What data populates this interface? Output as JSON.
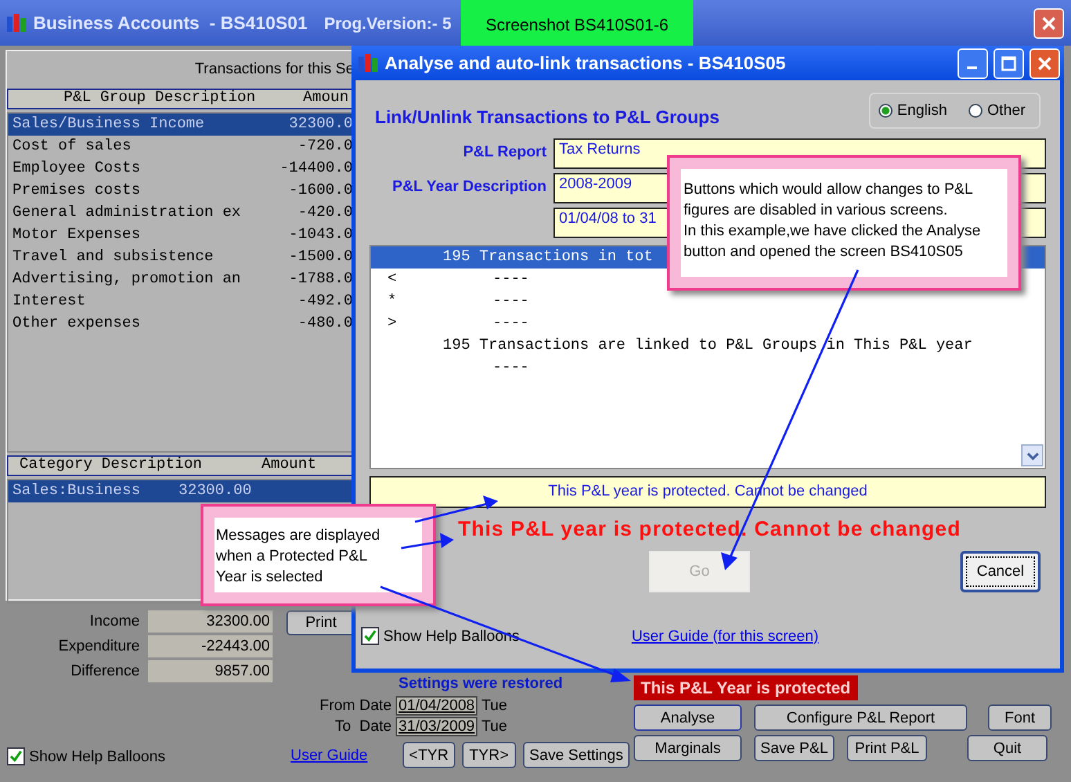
{
  "main_window": {
    "title": "Business Accounts  - BS410S01",
    "version": "Prog.Version:- 5",
    "heading": "Transactions for this Se",
    "group_table": {
      "columns": [
        "P&L Group Description",
        "Amoun"
      ],
      "rows": [
        {
          "description": "Sales/Business Income",
          "amount": "32300.0",
          "selected": true
        },
        {
          "description": "Cost of sales",
          "amount": "-720.0",
          "selected": false
        },
        {
          "description": "Employee Costs",
          "amount": "-14400.0",
          "selected": false
        },
        {
          "description": "Premises costs",
          "amount": "-1600.0",
          "selected": false
        },
        {
          "description": "General administration ex",
          "amount": "-420.0",
          "selected": false
        },
        {
          "description": "Motor Expenses",
          "amount": "-1043.0",
          "selected": false
        },
        {
          "description": "Travel and subsistence",
          "amount": "-1500.0",
          "selected": false
        },
        {
          "description": "Advertising, promotion an",
          "amount": "-1788.0",
          "selected": false
        },
        {
          "description": "Interest",
          "amount": "-492.0",
          "selected": false
        },
        {
          "description": "Other expenses",
          "amount": "-480.0",
          "selected": false
        }
      ]
    },
    "category_table": {
      "columns": [
        "Category Description",
        "Amount"
      ],
      "rows": [
        {
          "description": "Sales:Business",
          "amount": "32300.00",
          "selected": true
        }
      ]
    },
    "totals": [
      {
        "label": "Income",
        "value": "32300.00"
      },
      {
        "label": "Expenditure",
        "value": "-22443.00"
      },
      {
        "label": "Difference",
        "value": "9857.00"
      }
    ],
    "print_button": "Print",
    "show_help_balloons": {
      "label": "Show Help Balloons",
      "checked": true
    },
    "user_guide_link": "User Guide",
    "settings_message": "Settings were restored",
    "dates": [
      {
        "label": "From Date",
        "value": "01/04/2008",
        "day": "Tue"
      },
      {
        "label": "To  Date",
        "value": "31/03/2009",
        "day": "Tue"
      }
    ],
    "nav_buttons": [
      "<TYR",
      "TYR>",
      "Save Settings"
    ],
    "status_badge": "This P&L Year is protected",
    "action_rows": [
      [
        "Analyse",
        "Configure P&L Report",
        "Font"
      ],
      [
        "Marginals",
        "Save P&L",
        "Print P&L",
        "Quit"
      ]
    ]
  },
  "screenshot_label": "Screenshot BS410S01-6",
  "dialog": {
    "title": "Analyse and auto-link transactions - BS410S05",
    "heading": "Link/Unlink Transactions to P&L Groups",
    "language_options": [
      {
        "label": "English",
        "selected": true
      },
      {
        "label": "Other",
        "selected": false
      }
    ],
    "fields": [
      {
        "label": "P&L Report",
        "value": "Tax Returns"
      },
      {
        "label": "P&L Year Description",
        "value": "2008-2009"
      },
      {
        "value": "01/04/08 to 31"
      }
    ],
    "listing": {
      "header": "195 Transactions in tot",
      "lines": [
        {
          "kind": "dash",
          "marker": "<",
          "text": "----"
        },
        {
          "kind": "dash",
          "marker": "*",
          "text": "----"
        },
        {
          "kind": "dash",
          "marker": ">",
          "text": "----"
        },
        {
          "kind": "count",
          "text": "195 Transactions are linked to P&L Groups in This P&L year"
        },
        {
          "kind": "dash",
          "text": "----"
        }
      ]
    },
    "message_bar": "This P&L year is protected. Cannot be changed",
    "error_text": "This P&L year is protected. Cannot be changed",
    "go_button": {
      "label": "Go",
      "disabled": true
    },
    "cancel_button": "Cancel",
    "show_help_balloons": {
      "label": "Show Help Balloons",
      "checked": true
    },
    "user_guide_link": "User Guide (for this screen)"
  },
  "callouts": [
    {
      "text": "Buttons which would allow changes to P&L figures are disabled in various screens.\nIn this example,we have clicked the Analyse button and opened the screen BS410S05"
    },
    {
      "text": "Messages are displayed when a Protected P&L Year is selected"
    }
  ]
}
